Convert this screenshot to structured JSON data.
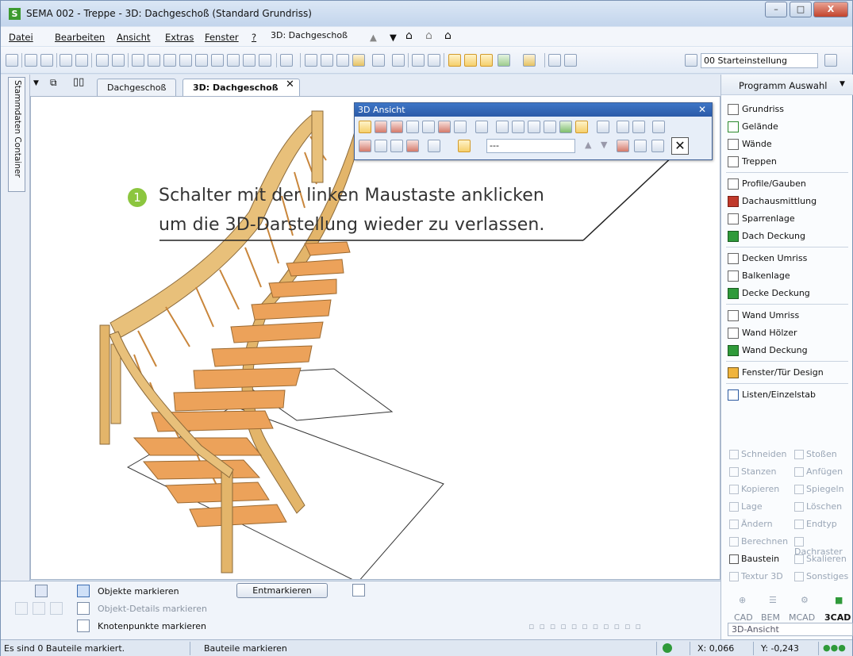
{
  "window": {
    "title": "SEMA  002 - Treppe  - 3D: Dachgeschoß (Standard Grundriss)",
    "app_logo": "S",
    "min_label": "–",
    "max_label": "□",
    "close_label": "X"
  },
  "menubar": {
    "items": [
      "Datei",
      "Bearbeiten",
      "Ansicht",
      "Extras",
      "Fenster",
      "?"
    ],
    "view_select": "3D: Dachgeschoß"
  },
  "toolbar": {
    "preset": "00 Starteinstellung"
  },
  "left_tab": "Stammdaten Container",
  "tabs": [
    {
      "label": "Dachgeschoß",
      "active": false
    },
    {
      "label": "3D: Dachgeschoß",
      "active": true
    }
  ],
  "tab_close": "✕",
  "dialog": {
    "title": "3D Ansicht",
    "close": "✕",
    "field_value": "---",
    "exit_button": "✕"
  },
  "callout": {
    "number": "1",
    "line1": "Schalter mit der linken Maustaste anklicken",
    "line2": "um die 3D-Darstellung wieder zu verlassen."
  },
  "panel": {
    "title": "Programm Auswahl",
    "items": [
      "Grundriss",
      "Gelände",
      "Wände",
      "Treppen",
      "Profile/Gauben",
      "Dachausmittlung",
      "Sparrenlage",
      "Dach Deckung",
      "Decken Umriss",
      "Balkenlage",
      "Decke Deckung",
      "Wand Umriss",
      "Wand Hölzer",
      "Wand Deckung",
      "Fenster/Tür Design",
      "Listen/Einzelstab"
    ],
    "tools": [
      [
        "Schneiden",
        "Stoßen"
      ],
      [
        "Stanzen",
        "Anfügen"
      ],
      [
        "Kopieren",
        "Spiegeln"
      ],
      [
        "Lage",
        "Löschen"
      ],
      [
        "Ändern",
        "Endtyp"
      ],
      [
        "Berechnen",
        "Dachraster"
      ],
      [
        "Baustein",
        "Skalieren"
      ],
      [
        "Textur 3D",
        "Sonstiges"
      ]
    ],
    "modes": [
      "CAD",
      "BEM",
      "MCAD",
      "3CAD"
    ],
    "view_field": "3D-Ansicht"
  },
  "bottom": {
    "mark_objects": "Objekte markieren",
    "mark_details": "Objekt-Details markieren",
    "mark_nodes": "Knotenpunkte markieren",
    "unmark_button": "Entmarkieren"
  },
  "status": {
    "message": "Es sind 0 Bauteile markiert.",
    "mode": "Bauteile markieren",
    "x": "X: 0,066",
    "y": "Y: -0,243"
  }
}
